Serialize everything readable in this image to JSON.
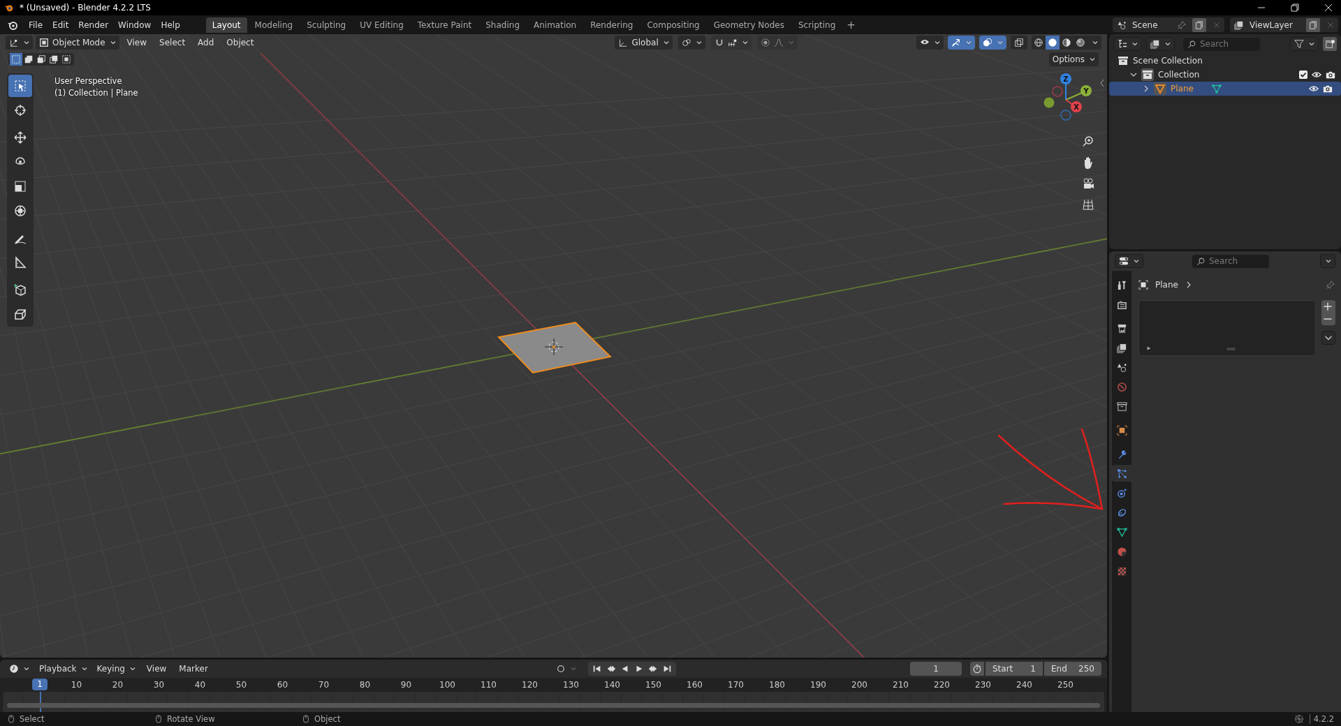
{
  "window": {
    "title": "* (Unsaved) - Blender 4.2.2 LTS"
  },
  "menu": [
    "File",
    "Edit",
    "Render",
    "Window",
    "Help"
  ],
  "workspaces": [
    {
      "label": "Layout",
      "selected": true
    },
    {
      "label": "Modeling",
      "selected": false
    },
    {
      "label": "Sculpting",
      "selected": false
    },
    {
      "label": "UV Editing",
      "selected": false
    },
    {
      "label": "Texture Paint",
      "selected": false
    },
    {
      "label": "Shading",
      "selected": false
    },
    {
      "label": "Animation",
      "selected": false
    },
    {
      "label": "Rendering",
      "selected": false
    },
    {
      "label": "Compositing",
      "selected": false
    },
    {
      "label": "Geometry Nodes",
      "selected": false
    },
    {
      "label": "Scripting",
      "selected": false
    }
  ],
  "add_workspace": "+",
  "scene": {
    "scene": "Scene",
    "view_layer": "ViewLayer"
  },
  "viewport": {
    "mode": "Object Mode",
    "menus": [
      "View",
      "Select",
      "Add",
      "Object"
    ],
    "orientation": "Global",
    "options": "Options",
    "toggles": [
      {
        "kind": "gizmo",
        "on": true
      },
      {
        "kind": "overlay",
        "on": true
      },
      {
        "kind": "xray",
        "on": false
      }
    ],
    "shading": [
      {
        "kind": "wireframe",
        "selected": false
      },
      {
        "kind": "solid",
        "selected": true
      },
      {
        "kind": "material",
        "selected": false
      },
      {
        "kind": "rendered",
        "selected": false
      }
    ],
    "overlay_text": [
      "User Perspective",
      "(1) Collection | Plane"
    ],
    "axes": [
      "Z",
      "Y",
      "X"
    ],
    "tools": [
      {
        "kind": "select",
        "selected": true
      },
      {
        "kind": "cursor",
        "selected": false
      },
      {
        "kind": "move",
        "selected": false
      },
      {
        "kind": "rotate",
        "selected": false
      },
      {
        "kind": "scale",
        "selected": false
      },
      {
        "kind": "transform",
        "selected": false
      },
      {
        "kind": "annotate",
        "selected": false
      },
      {
        "kind": "measure",
        "selected": false
      },
      {
        "kind": "add-cube",
        "selected": false
      },
      {
        "kind": "extrude",
        "selected": false
      }
    ]
  },
  "outliner": {
    "search_placeholder": "Search",
    "tree": [
      {
        "label": "Scene Collection",
        "kind": "collection",
        "children": [
          {
            "label": "Collection",
            "kind": "collection",
            "expanded": true,
            "checked": true,
            "selected": false,
            "children": [
              {
                "label": "Plane",
                "kind": "object",
                "expanded": false,
                "selected": true
              }
            ]
          }
        ]
      }
    ]
  },
  "properties": {
    "search_placeholder": "Search",
    "object": "Plane",
    "tabs": [
      {
        "kind": "tool",
        "selected": false
      },
      {
        "kind": "render",
        "selected": false
      },
      {
        "kind": "output",
        "selected": false
      },
      {
        "kind": "view-layer",
        "selected": false
      },
      {
        "kind": "scene",
        "selected": false
      },
      {
        "kind": "world",
        "selected": false
      },
      {
        "kind": "collection",
        "selected": false
      },
      {
        "kind": "object",
        "selected": false
      },
      {
        "kind": "modifiers",
        "selected": false
      },
      {
        "kind": "particles",
        "selected": true
      },
      {
        "kind": "physics",
        "selected": false
      },
      {
        "kind": "constraints",
        "selected": false
      },
      {
        "kind": "data",
        "selected": false
      },
      {
        "kind": "material",
        "selected": false
      },
      {
        "kind": "texture",
        "selected": false
      }
    ]
  },
  "timeline": {
    "menus": [
      "Playback",
      "Keying",
      "View",
      "Marker"
    ],
    "current_frame": "1",
    "start_label": "Start",
    "start": "1",
    "end_label": "End",
    "end": "250",
    "playhead": "1",
    "ruler": [
      "10",
      "20",
      "30",
      "40",
      "50",
      "60",
      "70",
      "80",
      "90",
      "100",
      "110",
      "120",
      "130",
      "140",
      "150",
      "160",
      "170",
      "180",
      "190",
      "200",
      "210",
      "220",
      "230",
      "240",
      "250"
    ]
  },
  "status_bar": {
    "items": [
      "Select",
      "Rotate View",
      "Object"
    ],
    "version": "4.2.2"
  }
}
